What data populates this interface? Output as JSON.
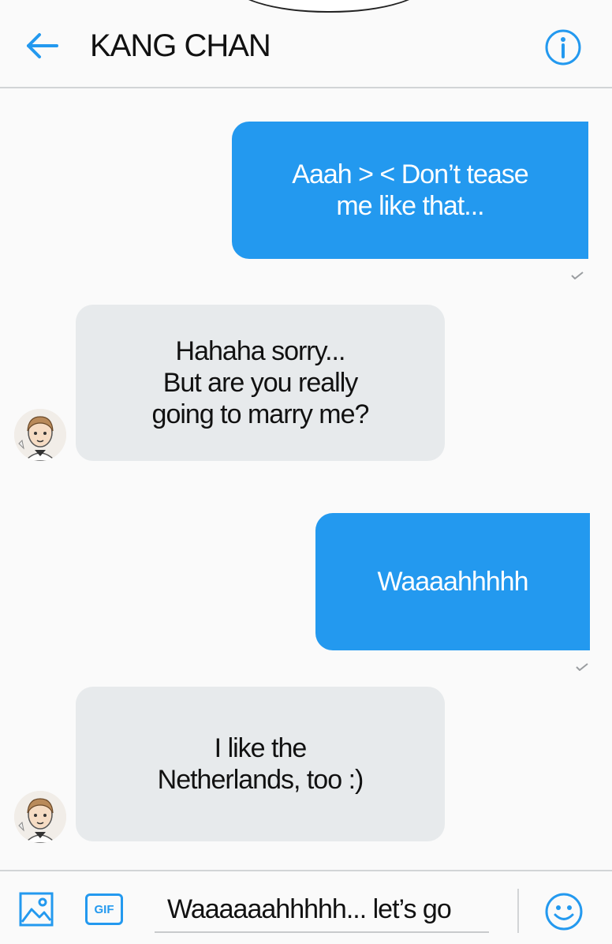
{
  "header": {
    "title": "KANG CHAN",
    "back_icon": "arrow-left-icon",
    "info_icon": "info-circle-icon"
  },
  "messages": [
    {
      "direction": "outgoing",
      "text": "Aaah > < Don’t tease\nme like that...",
      "status": "sent"
    },
    {
      "direction": "incoming",
      "text": "Hahaha sorry...\nBut are you really\ngoing to marry me?"
    },
    {
      "direction": "outgoing",
      "text": "Waaaahhhhh",
      "status": "sent"
    },
    {
      "direction": "incoming",
      "text": "I like the\nNetherlands, too :)"
    }
  ],
  "composer": {
    "image_icon": "image-icon",
    "gif_label": "GIF",
    "input_value": "Waaaaaahhhhh... let’s go",
    "emoji_icon": "smiley-icon"
  },
  "colors": {
    "accent": "#2399ef",
    "incoming_bubble": "#e7eaec",
    "divider": "#d2d4d6"
  }
}
